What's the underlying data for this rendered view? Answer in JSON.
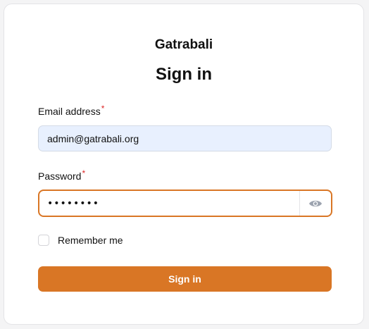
{
  "brand": {
    "name": "Gatrabali"
  },
  "form": {
    "title": "Sign in",
    "email": {
      "label": "Email address",
      "required_mark": "*",
      "value": "admin@gatrabali.org"
    },
    "password": {
      "label": "Password",
      "required_mark": "*",
      "value": "••••••••",
      "toggle_icon": "eye-icon"
    },
    "remember": {
      "label": "Remember me",
      "checked": false
    },
    "submit_label": "Sign in"
  },
  "colors": {
    "primary": "#d97625",
    "autofill_bg": "#e8f0fe",
    "required": "#dc2626"
  }
}
